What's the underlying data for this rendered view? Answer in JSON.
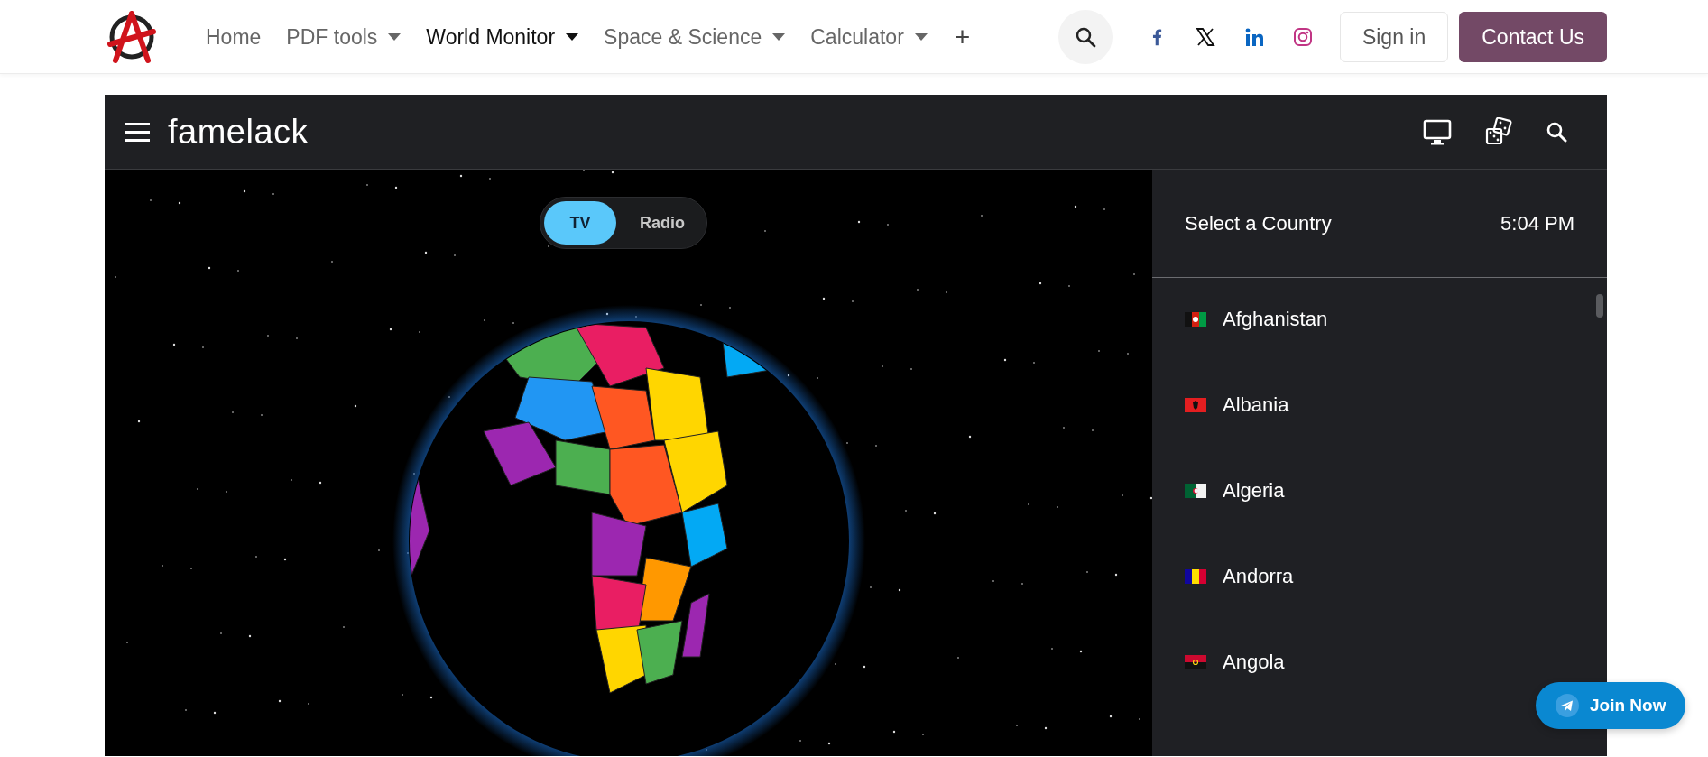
{
  "header": {
    "nav": [
      {
        "label": "Home",
        "dropdown": false,
        "selected": false
      },
      {
        "label": "PDF tools",
        "dropdown": true,
        "selected": false
      },
      {
        "label": "World Monitor",
        "dropdown": true,
        "selected": true
      },
      {
        "label": "Space & Science",
        "dropdown": true,
        "selected": false
      },
      {
        "label": "Calculator",
        "dropdown": true,
        "selected": false
      }
    ],
    "more_label": "+",
    "sign_in": "Sign in",
    "contact": "Contact Us"
  },
  "app": {
    "brand": "famelack",
    "toggle": [
      {
        "label": "TV",
        "selected": true
      },
      {
        "label": "Radio",
        "selected": false
      }
    ],
    "sidebar": {
      "title": "Select a Country",
      "time": "5:04 PM",
      "countries": [
        {
          "name": "Afghanistan"
        },
        {
          "name": "Albania"
        },
        {
          "name": "Algeria"
        },
        {
          "name": "Andorra"
        },
        {
          "name": "Angola"
        }
      ]
    }
  },
  "join_button": "Join Now"
}
